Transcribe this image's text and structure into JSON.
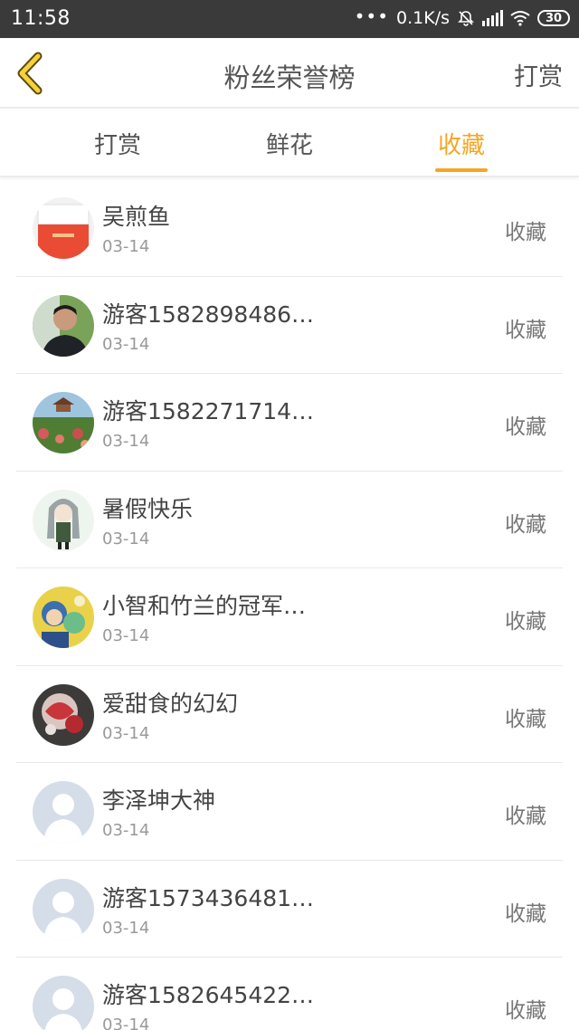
{
  "status_bar": {
    "time": "11:58",
    "dots": "•••",
    "speed": "0.1K/s",
    "battery": "30",
    "icons": [
      "muted-bell-icon",
      "signal-icon",
      "wifi-icon",
      "battery-icon"
    ]
  },
  "header": {
    "title": "粉丝荣誉榜",
    "action_label": "打赏",
    "back_icon": "chevron-left-icon"
  },
  "tabs": [
    {
      "label": "打赏",
      "active": false
    },
    {
      "label": "鲜花",
      "active": false
    },
    {
      "label": "收藏",
      "active": true
    }
  ],
  "colors": {
    "accent": "#f5a623",
    "status_bar": "#3a3a3a",
    "text": "#555555",
    "muted_text": "#999999"
  },
  "list": [
    {
      "name": "吴煎鱼",
      "date": "03-14",
      "action": "收藏",
      "avatar": "red-envelope-photo"
    },
    {
      "name": "游客1582898486…",
      "date": "03-14",
      "action": "收藏",
      "avatar": "person-photo"
    },
    {
      "name": "游客1582271714…",
      "date": "03-14",
      "action": "收藏",
      "avatar": "garden-photo"
    },
    {
      "name": "暑假快乐",
      "date": "03-14",
      "action": "收藏",
      "avatar": "anime-girl-photo"
    },
    {
      "name": "小智和竹兰的冠军…",
      "date": "03-14",
      "action": "收藏",
      "avatar": "cartoon-photo"
    },
    {
      "name": "爱甜食的幻幻",
      "date": "03-14",
      "action": "收藏",
      "avatar": "dessert-photo"
    },
    {
      "name": "李泽坤大神",
      "date": "03-14",
      "action": "收藏",
      "avatar": "default-user-icon"
    },
    {
      "name": "游客1573436481…",
      "date": "03-14",
      "action": "收藏",
      "avatar": "default-user-icon"
    },
    {
      "name": "游客1582645422…",
      "date": "03-14",
      "action": "收藏",
      "avatar": "default-user-icon"
    }
  ]
}
